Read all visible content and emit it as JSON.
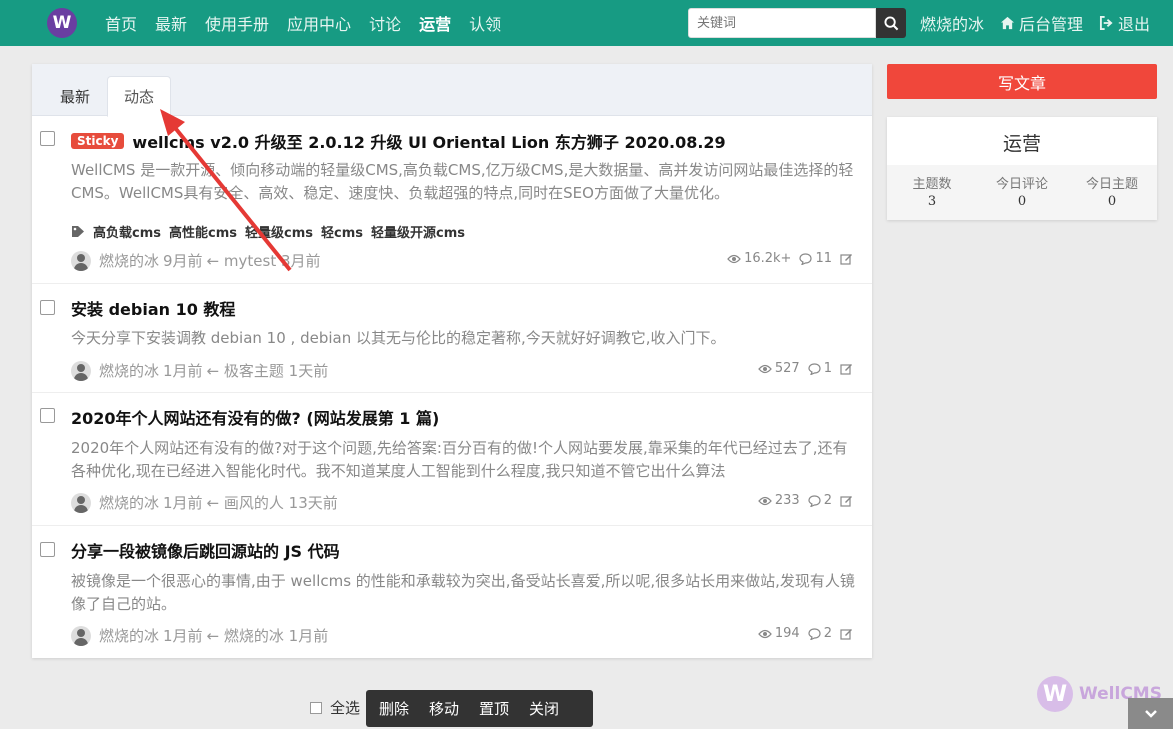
{
  "nav": {
    "logo": "W",
    "links": [
      "首页",
      "最新",
      "使用手册",
      "应用中心",
      "讨论",
      "运营",
      "认领"
    ],
    "active_index": 5,
    "search_placeholder": "关键词",
    "user": "燃烧的冰",
    "admin": "后台管理",
    "logout": "退出"
  },
  "tabs": [
    "最新",
    "动态"
  ],
  "active_tab": "动态",
  "threads": [
    {
      "sticky": "Sticky",
      "title": "wellcms v2.0 升级至 2.0.12 升级 UI Oriental Lion 东方狮子 2020.08.29",
      "brief": "WellCMS 是一款开源、倾向移动端的轻量级CMS,高负载CMS,亿万级CMS,是大数据量、高并发访问网站最佳选择的轻CMS。WellCMS具有安全、高效、稳定、速度快、负载超强的特点,同时在SEO方面做了大量优化。",
      "tags": [
        "高负载cms",
        "高性能cms",
        "轻量级cms",
        "轻cms",
        "轻量级开源cms"
      ],
      "author": "燃烧的冰",
      "time": "9月前",
      "last": "← mytest 3月前",
      "views": "16.2k+",
      "replies": "11"
    },
    {
      "title": "安装 debian 10 教程",
      "brief": "今天分享下安装调教 debian 10 , debian 以其无与伦比的稳定著称,今天就好好调教它,收入门下。",
      "author": "燃烧的冰",
      "time": "1月前",
      "last": "← 极客主题 1天前",
      "views": "527",
      "replies": "1"
    },
    {
      "title": "2020年个人网站还有没有的做? (网站发展第 1 篇)",
      "brief": "2020年个人网站还有没有的做?对于这个问题,先给答案:百分百有的做!个人网站要发展,靠采集的年代已经过去了,还有各种优化,现在已经进入智能化时代。我不知道某度人工智能到什么程度,我只知道不管它出什么算法",
      "author": "燃烧的冰",
      "time": "1月前",
      "last": "← 画风的人 13天前",
      "views": "233",
      "replies": "2"
    },
    {
      "title": "分享一段被镜像后跳回源站的 JS 代码",
      "brief": "被镜像是一个很恶心的事情,由于 wellcms 的性能和承载较为突出,备受站长喜爱,所以呢,很多站长用来做站,发现有人镜像了自己的站。",
      "author": "燃烧的冰",
      "time": "1月前",
      "last": "← 燃烧的冰 1月前",
      "views": "194",
      "replies": "2"
    }
  ],
  "sidebar": {
    "write_button": "写文章",
    "forum_name": "运营",
    "stats": [
      {
        "label": "主题数",
        "value": "3"
      },
      {
        "label": "今日评论",
        "value": "0"
      },
      {
        "label": "今日主题",
        "value": "0"
      }
    ]
  },
  "mod": {
    "select_all": "全选",
    "buttons": [
      "删除",
      "移动",
      "置顶",
      "关闭"
    ]
  },
  "watermark": "WellCMS",
  "colors": {
    "navbar": "#179b83",
    "write_button": "#f0473b",
    "sticky": "#e74c3c",
    "annotation_arrow": "#e53935"
  }
}
